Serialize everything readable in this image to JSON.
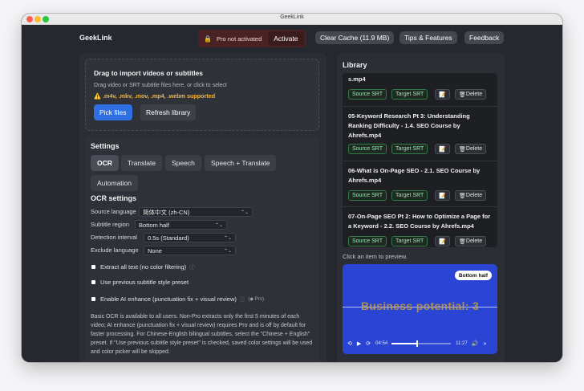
{
  "window": {
    "title": "GeekLink"
  },
  "header": {
    "brand": "GeekLink",
    "pro_status": "Pro not activated",
    "activate_label": "Activate",
    "clear_cache_label": "Clear Cache (11.9 MB)",
    "tips_label": "Tips & Features",
    "feedback_label": "Feedback"
  },
  "drop": {
    "title": "Drag to import videos or subtitles",
    "subtitle": "Drag video or SRT subtitle files here, or click to select",
    "warning": ".m4v, .mkv, .mov, .mp4, .webm supported",
    "pick_files_label": "Pick files",
    "refresh_label": "Refresh library"
  },
  "settings": {
    "title": "Settings",
    "tabs": [
      "OCR",
      "Translate",
      "Speech",
      "Speech + Translate",
      "Automation"
    ],
    "active_tab": "OCR",
    "ocr_title": "OCR settings",
    "source_language": {
      "label": "Source language",
      "value": "简体中文 (zh-CN)"
    },
    "subtitle_region": {
      "label": "Subtitle region",
      "value": "Bottom half"
    },
    "detection_interval": {
      "label": "Detection interval",
      "value": "0.5s (Standard)"
    },
    "exclude_language": {
      "label": "Exclude language",
      "value": "None"
    },
    "checks": [
      {
        "label": "Extract all text (no color filtering)",
        "info": "ⓘ",
        "pro": ""
      },
      {
        "label": "Use previous subtitle style preset",
        "info": "",
        "pro": ""
      },
      {
        "label": "Enable AI enhance (punctuation fix + visual review)",
        "info": "ⓘ",
        "pro": "(◆ Pro)"
      }
    ],
    "note": "Basic OCR is available to all users. Non-Pro extracts only the first 5 minutes of each video; AI enhance (punctuation fix + visual review) requires Pro and is off by default for faster processing. For Chinese-English bilingual subtitles, select the \"Chinese + English\" preset. If \"Use previous subtitle style preset\" is checked, saved color settings will be used and color picker will be skipped."
  },
  "library": {
    "title": "Library",
    "items": [
      {
        "title": "s.mp4"
      },
      {
        "title": "05-Keyword Research Pt 3: Understanding Ranking Difficulty - 1.4. SEO Course by Ahrefs.mp4"
      },
      {
        "title": "06-What is On-Page SEO - 2.1. SEO Course by Ahrefs.mp4"
      },
      {
        "title": "07-On-Page SEO Pt 2: How to Optimize a Page for a Keyword - 2.2. SEO Course by Ahrefs.mp4"
      }
    ],
    "source_srt_label": "Source SRT",
    "target_srt_label": "Target SRT",
    "delete_label": "Delete",
    "preview_hint": "Click an item to preview.",
    "preview": {
      "region_badge": "Bottom half",
      "subtitle_text": "Business potential: 3",
      "current_time": "04:54",
      "duration": "11:27",
      "progress": 0.43
    }
  }
}
